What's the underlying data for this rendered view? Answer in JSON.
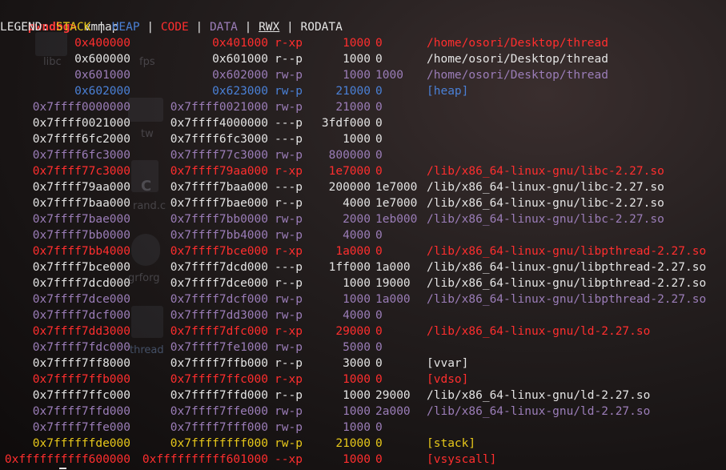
{
  "prompt": {
    "name": "pwndbg>",
    "command": "vmmap"
  },
  "legend": {
    "prefix": "LEGEND: ",
    "sep": " | ",
    "items": [
      {
        "label": "STACK",
        "color": "#e8c81a",
        "underline": false
      },
      {
        "label": "HEAP",
        "color": "#4a80d6",
        "underline": false
      },
      {
        "label": "CODE",
        "color": "#ff2e2e",
        "underline": false
      },
      {
        "label": "DATA",
        "color": "#9b7db8",
        "underline": false
      },
      {
        "label": "RWX",
        "color": "#e4e4e4",
        "underline": true
      },
      {
        "label": "RODATA",
        "color": "#e4e4e4",
        "underline": false
      }
    ]
  },
  "colors": {
    "STACK": "#e8c81a",
    "HEAP": "#4a80d6",
    "CODE": "#ff2e2e",
    "DATA": "#9b7db8",
    "RODATA": "#e4e4e4"
  },
  "desktop_ghosts": [
    "libc",
    "fps",
    "tw",
    "C",
    "rand.c",
    "grforg",
    "thread"
  ],
  "mappings": [
    {
      "start": "0x400000",
      "end": "0x401000",
      "perm": "r-xp",
      "size": "1000",
      "offset": "0",
      "path": "/home/osori/Desktop/thread",
      "type": "CODE"
    },
    {
      "start": "0x600000",
      "end": "0x601000",
      "perm": "r--p",
      "size": "1000",
      "offset": "0",
      "path": "/home/osori/Desktop/thread",
      "type": "RODATA"
    },
    {
      "start": "0x601000",
      "end": "0x602000",
      "perm": "rw-p",
      "size": "1000",
      "offset": "1000",
      "path": "/home/osori/Desktop/thread",
      "type": "DATA"
    },
    {
      "start": "0x602000",
      "end": "0x623000",
      "perm": "rw-p",
      "size": "21000",
      "offset": "0",
      "path": "[heap]",
      "type": "HEAP"
    },
    {
      "start": "0x7ffff0000000",
      "end": "0x7ffff0021000",
      "perm": "rw-p",
      "size": "21000",
      "offset": "0",
      "path": "",
      "type": "DATA"
    },
    {
      "start": "0x7ffff0021000",
      "end": "0x7ffff4000000",
      "perm": "---p",
      "size": "3fdf000",
      "offset": "0",
      "path": "",
      "type": "RODATA"
    },
    {
      "start": "0x7ffff6fc2000",
      "end": "0x7ffff6fc3000",
      "perm": "---p",
      "size": "1000",
      "offset": "0",
      "path": "",
      "type": "RODATA"
    },
    {
      "start": "0x7ffff6fc3000",
      "end": "0x7ffff77c3000",
      "perm": "rw-p",
      "size": "800000",
      "offset": "0",
      "path": "",
      "type": "DATA"
    },
    {
      "start": "0x7ffff77c3000",
      "end": "0x7ffff79aa000",
      "perm": "r-xp",
      "size": "1e7000",
      "offset": "0",
      "path": "/lib/x86_64-linux-gnu/libc-2.27.so",
      "type": "CODE"
    },
    {
      "start": "0x7ffff79aa000",
      "end": "0x7ffff7baa000",
      "perm": "---p",
      "size": "200000",
      "offset": "1e7000",
      "path": "/lib/x86_64-linux-gnu/libc-2.27.so",
      "type": "RODATA"
    },
    {
      "start": "0x7ffff7baa000",
      "end": "0x7ffff7bae000",
      "perm": "r--p",
      "size": "4000",
      "offset": "1e7000",
      "path": "/lib/x86_64-linux-gnu/libc-2.27.so",
      "type": "RODATA"
    },
    {
      "start": "0x7ffff7bae000",
      "end": "0x7ffff7bb0000",
      "perm": "rw-p",
      "size": "2000",
      "offset": "1eb000",
      "path": "/lib/x86_64-linux-gnu/libc-2.27.so",
      "type": "DATA"
    },
    {
      "start": "0x7ffff7bb0000",
      "end": "0x7ffff7bb4000",
      "perm": "rw-p",
      "size": "4000",
      "offset": "0",
      "path": "",
      "type": "DATA"
    },
    {
      "start": "0x7ffff7bb4000",
      "end": "0x7ffff7bce000",
      "perm": "r-xp",
      "size": "1a000",
      "offset": "0",
      "path": "/lib/x86_64-linux-gnu/libpthread-2.27.so",
      "type": "CODE"
    },
    {
      "start": "0x7ffff7bce000",
      "end": "0x7ffff7dcd000",
      "perm": "---p",
      "size": "1ff000",
      "offset": "1a000",
      "path": "/lib/x86_64-linux-gnu/libpthread-2.27.so",
      "type": "RODATA"
    },
    {
      "start": "0x7ffff7dcd000",
      "end": "0x7ffff7dce000",
      "perm": "r--p",
      "size": "1000",
      "offset": "19000",
      "path": "/lib/x86_64-linux-gnu/libpthread-2.27.so",
      "type": "RODATA"
    },
    {
      "start": "0x7ffff7dce000",
      "end": "0x7ffff7dcf000",
      "perm": "rw-p",
      "size": "1000",
      "offset": "1a000",
      "path": "/lib/x86_64-linux-gnu/libpthread-2.27.so",
      "type": "DATA"
    },
    {
      "start": "0x7ffff7dcf000",
      "end": "0x7ffff7dd3000",
      "perm": "rw-p",
      "size": "4000",
      "offset": "0",
      "path": "",
      "type": "DATA"
    },
    {
      "start": "0x7ffff7dd3000",
      "end": "0x7ffff7dfc000",
      "perm": "r-xp",
      "size": "29000",
      "offset": "0",
      "path": "/lib/x86_64-linux-gnu/ld-2.27.so",
      "type": "CODE"
    },
    {
      "start": "0x7ffff7fdc000",
      "end": "0x7ffff7fe1000",
      "perm": "rw-p",
      "size": "5000",
      "offset": "0",
      "path": "",
      "type": "DATA"
    },
    {
      "start": "0x7ffff7ff8000",
      "end": "0x7ffff7ffb000",
      "perm": "r--p",
      "size": "3000",
      "offset": "0",
      "path": "[vvar]",
      "type": "RODATA"
    },
    {
      "start": "0x7ffff7ffb000",
      "end": "0x7ffff7ffc000",
      "perm": "r-xp",
      "size": "1000",
      "offset": "0",
      "path": "[vdso]",
      "type": "CODE"
    },
    {
      "start": "0x7ffff7ffc000",
      "end": "0x7ffff7ffd000",
      "perm": "r--p",
      "size": "1000",
      "offset": "29000",
      "path": "/lib/x86_64-linux-gnu/ld-2.27.so",
      "type": "RODATA"
    },
    {
      "start": "0x7ffff7ffd000",
      "end": "0x7ffff7ffe000",
      "perm": "rw-p",
      "size": "1000",
      "offset": "2a000",
      "path": "/lib/x86_64-linux-gnu/ld-2.27.so",
      "type": "DATA"
    },
    {
      "start": "0x7ffff7ffe000",
      "end": "0x7ffff7fff000",
      "perm": "rw-p",
      "size": "1000",
      "offset": "0",
      "path": "",
      "type": "DATA"
    },
    {
      "start": "0x7ffffffde000",
      "end": "0x7ffffffff000",
      "perm": "rw-p",
      "size": "21000",
      "offset": "0",
      "path": "[stack]",
      "type": "STACK"
    },
    {
      "start": "0xffffffffff600000",
      "end": "0xffffffffff601000",
      "perm": "--xp",
      "size": "1000",
      "offset": "0",
      "path": "[vsyscall]",
      "type": "CODE"
    }
  ]
}
